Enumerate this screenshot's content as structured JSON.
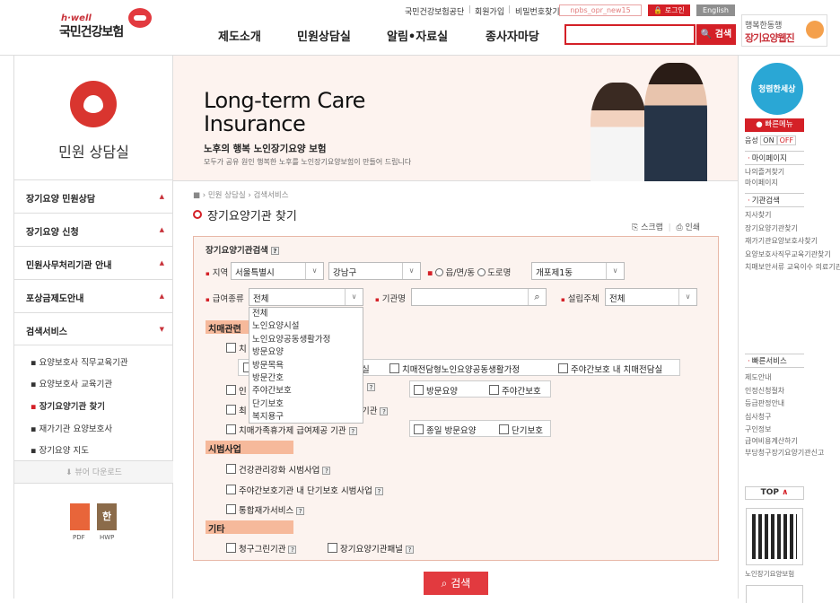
{
  "header": {
    "logo_sub": "h·well",
    "logo_main": "국민건강보험",
    "util_links": [
      "국민건강보험공단",
      "회원가입",
      "비밀번호찾기"
    ],
    "user_id": "npbs_opr_new15",
    "login_label": "로그인",
    "english_label": "English",
    "gnb": [
      "제도소개",
      "민원상담실",
      "알림•자료실",
      "종사자마당"
    ],
    "search_button": "검색",
    "partner_line1": "행복한동행",
    "partner_line2": "장기요양웹진"
  },
  "sidebar": {
    "title": "민원 상담실",
    "menus": [
      "장기요양 민원상담",
      "장기요양 신청",
      "민원사무처리기관 안내",
      "포상금제도안내",
      "검색서비스"
    ],
    "submenus": [
      "요양보호사 직무교육기관",
      "요양보호사 교육기관",
      "장기요양기관 찾기",
      "재가기관 요양보호사",
      "장기요양 지도"
    ],
    "viewer_download": "뷰어 다운로드",
    "files": [
      "PDF",
      "HWP"
    ]
  },
  "banner": {
    "title_line1": "Long-term Care",
    "title_line2": "Insurance",
    "subtitle": "노후의 행복 노인장기요양 보험",
    "desc": "모두가 공유 원인 행복한 노후를 노인장기요양보험이 만들어 드립니다"
  },
  "content": {
    "breadcrumb": "› 민원 상담실 › 검색서비스",
    "title": "장기요양기관 찾기",
    "scrap": "스크랩",
    "print": "인쇄",
    "search_title": "장기요양기관검색",
    "region_label": "지역",
    "region_city": "서울특별시",
    "region_district": "강남구",
    "radio1": "읍/면/동",
    "radio2": "도로명",
    "region_dong": "개포제1동",
    "benefit_label": "급여종류",
    "benefit_value": "전체",
    "org_label": "기관명",
    "founder_label": "설립주체",
    "founder_value": "전체",
    "benefit_options": [
      "전체",
      "노인요양시설",
      "노인요양공동생활가정",
      "방문요양",
      "방문목욕",
      "방문간호",
      "주야간보호",
      "단기보호",
      "복지용구"
    ],
    "sections": {
      "dementia": "치매관련",
      "pilot": "시범사업",
      "etc": "기타"
    },
    "dementia_items": {
      "r1_left": "치",
      "r2_a": "실",
      "r2_b": "치매전담형노인요양공동생활가정",
      "r2_c": "주야간보호 내 치매전담실",
      "r3_left": "인",
      "r3_b": "방문요양",
      "r3_c": "주야간보호",
      "r4_left": "최",
      "r4_right": "기관",
      "r5_left": "치매가족휴가제 급여제공 기관",
      "r5_b": "종일 방문요양",
      "r5_c": "단기보호"
    },
    "pilot_items": [
      "건강관리강화 시범사업",
      "주야간보호기관 내 단기보호 시범사업",
      "통합재가서비스"
    ],
    "etc_items": [
      "청구그린기관",
      "장기요양기관패널"
    ],
    "search_button": "검색"
  },
  "right": {
    "badge": "청렴한세상",
    "quick_menu": "빠른메뉴",
    "voice": "음성",
    "on": "ON",
    "off": "OFF",
    "mypage_head": "마이페이지",
    "mypage_items": [
      "나의즐겨찾기",
      "마이페이지"
    ],
    "org_head": "기관검색",
    "org_items": [
      "지사찾기",
      "장기요양기관찾기",
      "재가기관요양보호사찾기",
      "요양보호사직무교육기관찾기",
      "치매보안서류 교육이수 의료기관"
    ],
    "quick_head": "빠른서비스",
    "quick_items": [
      "제도안내",
      "인정신청절차",
      "등급판정안내",
      "심사청구",
      "구인정보",
      "급여비용계산하기",
      "부당청구장기요양기관신고"
    ],
    "top": "TOP",
    "qr_label": "노인장기요양보험"
  }
}
